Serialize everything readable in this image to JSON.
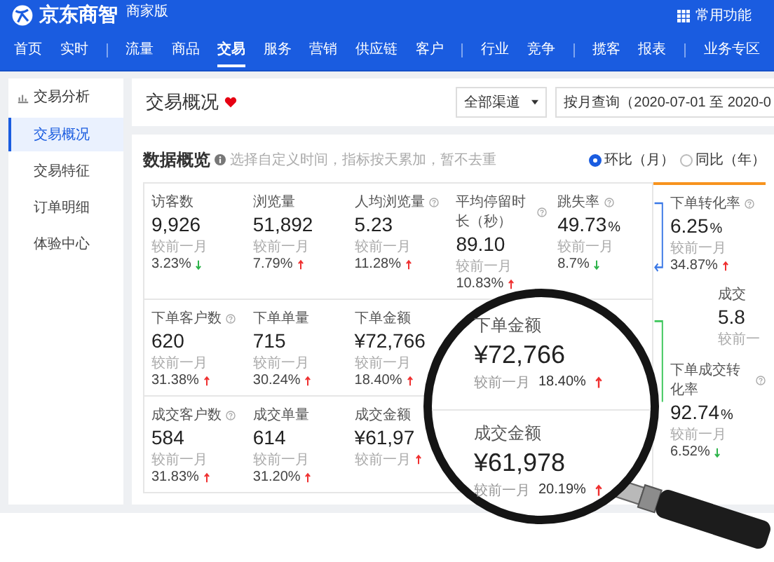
{
  "brand": {
    "name": "京东商智",
    "edition": "商家版"
  },
  "shortcut": "常用功能",
  "nav_groups": [
    [
      {
        "label": "首页",
        "selected": false
      },
      {
        "label": "实时",
        "selected": false
      }
    ],
    [
      {
        "label": "流量",
        "selected": false
      },
      {
        "label": "商品",
        "selected": false
      },
      {
        "label": "交易",
        "selected": true
      },
      {
        "label": "服务",
        "selected": false
      },
      {
        "label": "营销",
        "selected": false
      },
      {
        "label": "供应链",
        "selected": false
      },
      {
        "label": "客户",
        "selected": false
      }
    ],
    [
      {
        "label": "行业",
        "selected": false
      },
      {
        "label": "竞争",
        "selected": false
      }
    ],
    [
      {
        "label": "揽客",
        "selected": false
      },
      {
        "label": "报表",
        "selected": false
      }
    ],
    [
      {
        "label": "业务专区",
        "selected": false
      }
    ]
  ],
  "sidebar": {
    "section": "交易分析",
    "items": [
      {
        "label": "交易概况",
        "selected": true
      },
      {
        "label": "交易特征",
        "selected": false
      },
      {
        "label": "订单明细",
        "selected": false
      },
      {
        "label": "体验中心",
        "selected": false
      }
    ]
  },
  "page_title": "交易概况",
  "filters": {
    "channel": "全部渠道",
    "date_range": "按月查询（2020-07-01 至 2020-0"
  },
  "overview": {
    "title": "数据概览",
    "hint": "选择自定义时间，指标按天累加，暂不去重",
    "compare": [
      {
        "label": "环比（月）",
        "selected": true
      },
      {
        "label": "同比（年）",
        "selected": false
      }
    ],
    "metrics": [
      [
        {
          "label": "访客数",
          "help": false,
          "value": "9,926",
          "change_label": "较前一月",
          "change": "3.23%",
          "rising": false
        },
        {
          "label": "浏览量",
          "help": false,
          "value": "51,892",
          "change_label": "较前一月",
          "change": "7.79%",
          "rising": true
        },
        {
          "label": "人均浏览量",
          "help": true,
          "value": "5.23",
          "change_label": "较前一月",
          "change": "11.28%",
          "rising": true
        },
        {
          "label": "平均停留时长（秒）",
          "help": true,
          "value": "89.10",
          "change_label": "较前一月",
          "change": "10.83%",
          "rising": true
        },
        {
          "label": "跳失率",
          "help": true,
          "value": "49.73",
          "unit": "%",
          "change_label": "较前一月",
          "change": "8.7%",
          "rising": false
        }
      ],
      [
        {
          "label": "下单客户数",
          "help": true,
          "value": "620",
          "change_label": "较前一月",
          "change": "31.38%",
          "rising": true
        },
        {
          "label": "下单单量",
          "help": false,
          "value": "715",
          "change_label": "较前一月",
          "change": "30.24%",
          "rising": true
        },
        {
          "label": "下单金额",
          "help": false,
          "value": "¥72,766",
          "change_label": "较前一月",
          "change": "18.40%",
          "rising": true
        }
      ],
      [
        {
          "label": "成交客户数",
          "help": true,
          "value": "584",
          "change_label": "较前一月",
          "change": "31.83%",
          "rising": true
        },
        {
          "label": "成交单量",
          "help": false,
          "value": "614",
          "change_label": "较前一月",
          "change": "31.20%",
          "rising": true
        },
        {
          "label": "成交金额",
          "help": false,
          "value": "¥61,97",
          "change_label": "较前一月",
          "rising": true
        }
      ]
    ],
    "funnel": [
      {
        "kind": "main",
        "label": "下单转化率",
        "help": true,
        "value": "6.25",
        "unit": "%",
        "change_label": "较前一月",
        "change": "34.87%",
        "rising": true
      },
      {
        "kind": "side",
        "label": "成交",
        "help": false,
        "value": "5.8",
        "change_label": "较前一"
      },
      {
        "kind": "main",
        "label": "下单成交转化率",
        "help": true,
        "value": "92.74",
        "unit": "%",
        "change_label": "较前一月",
        "change": "6.52%",
        "rising": false
      }
    ]
  },
  "magnifier": [
    {
      "label": "下单金额",
      "value": "¥72,766",
      "change_label": "较前一月",
      "change": "18.40%",
      "rising": true
    },
    {
      "label": "成交金额",
      "value": "¥61,978",
      "change_label": "较前一月",
      "change": "20.19%",
      "rising": true
    }
  ]
}
